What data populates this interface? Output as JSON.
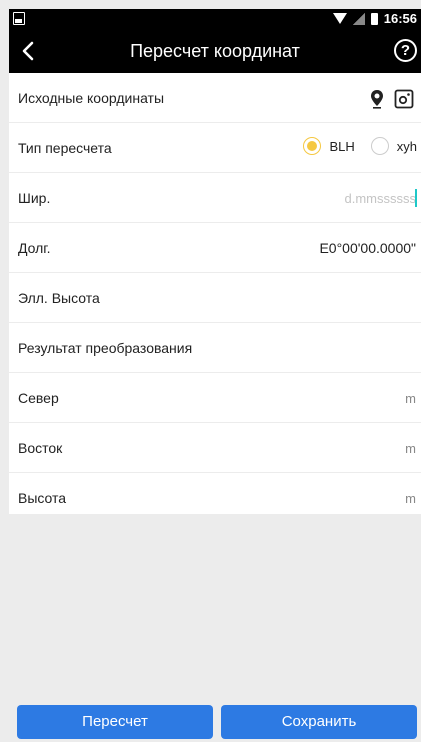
{
  "status_bar": {
    "time": "16:56"
  },
  "toolbar": {
    "title": "Пересчет координат",
    "help_label": "?"
  },
  "source_section": {
    "label": "Исходные координаты"
  },
  "conversion_type": {
    "label": "Тип пересчета",
    "options": [
      "BLH",
      "xyh"
    ],
    "selected": "BLH"
  },
  "fields": {
    "latitude": {
      "label": "Шир.",
      "value": "",
      "placeholder": "d.mmssssss"
    },
    "longitude": {
      "label": "Долг.",
      "value": "E0°00'00.0000\""
    },
    "ellipsoid_height": {
      "label": "Элл. Высота",
      "value": ""
    }
  },
  "result_section": {
    "label": "Результат преобразования"
  },
  "results": [
    {
      "label": "Север",
      "unit": "m"
    },
    {
      "label": "Восток",
      "unit": "m"
    },
    {
      "label": "Высота",
      "unit": "m"
    }
  ],
  "buttons": {
    "recalc": "Пересчет",
    "save": "Сохранить"
  },
  "colors": {
    "accent": "#2d7ae3",
    "radio_selected": "#f5c842",
    "toolbar": "#000000",
    "cursor": "#1ec8c8"
  }
}
